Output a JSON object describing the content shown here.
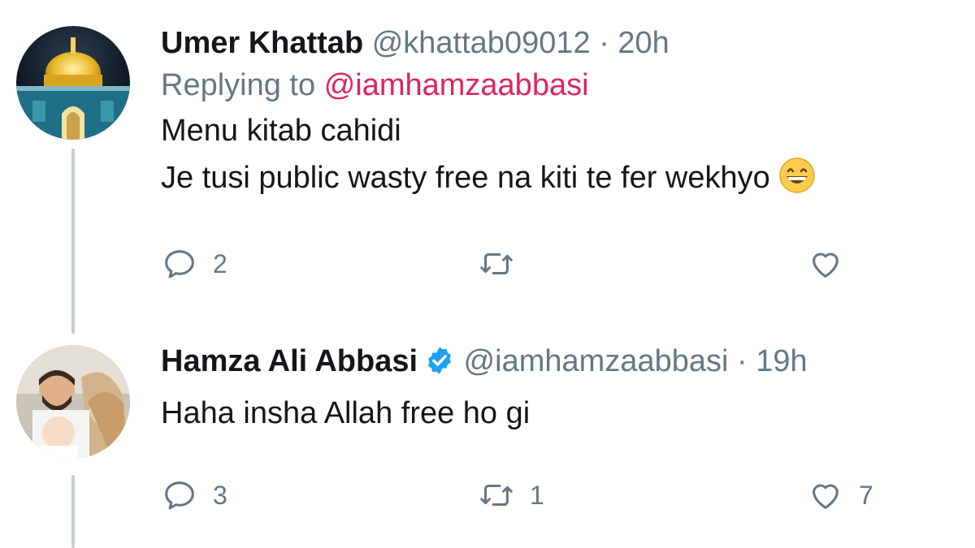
{
  "tweets": [
    {
      "name": "Umer Khattab",
      "handle": "@khattab09012",
      "dot": "·",
      "time": "20h",
      "replying_prefix": "Replying to",
      "replying_to": "@iamhamzaabbasi",
      "lines": [
        "Menu kitab cahidi",
        "Je tusi public wasty free na kiti te fer wekhyo"
      ],
      "emoji": "grinning-face",
      "replies": "2",
      "retweets": "",
      "likes": ""
    },
    {
      "name": "Hamza Ali Abbasi",
      "verified": true,
      "handle": "@iamhamzaabbasi",
      "dot": "·",
      "time": "19h",
      "lines": [
        "Haha insha Allah free ho gi"
      ],
      "replies": "3",
      "retweets": "1",
      "likes": "7"
    }
  ],
  "colors": {
    "text": "#14171a",
    "secondary": "#657786",
    "mention": "#e0245e",
    "verified": "#1da1f2",
    "thread_line": "#c4cfd6"
  }
}
